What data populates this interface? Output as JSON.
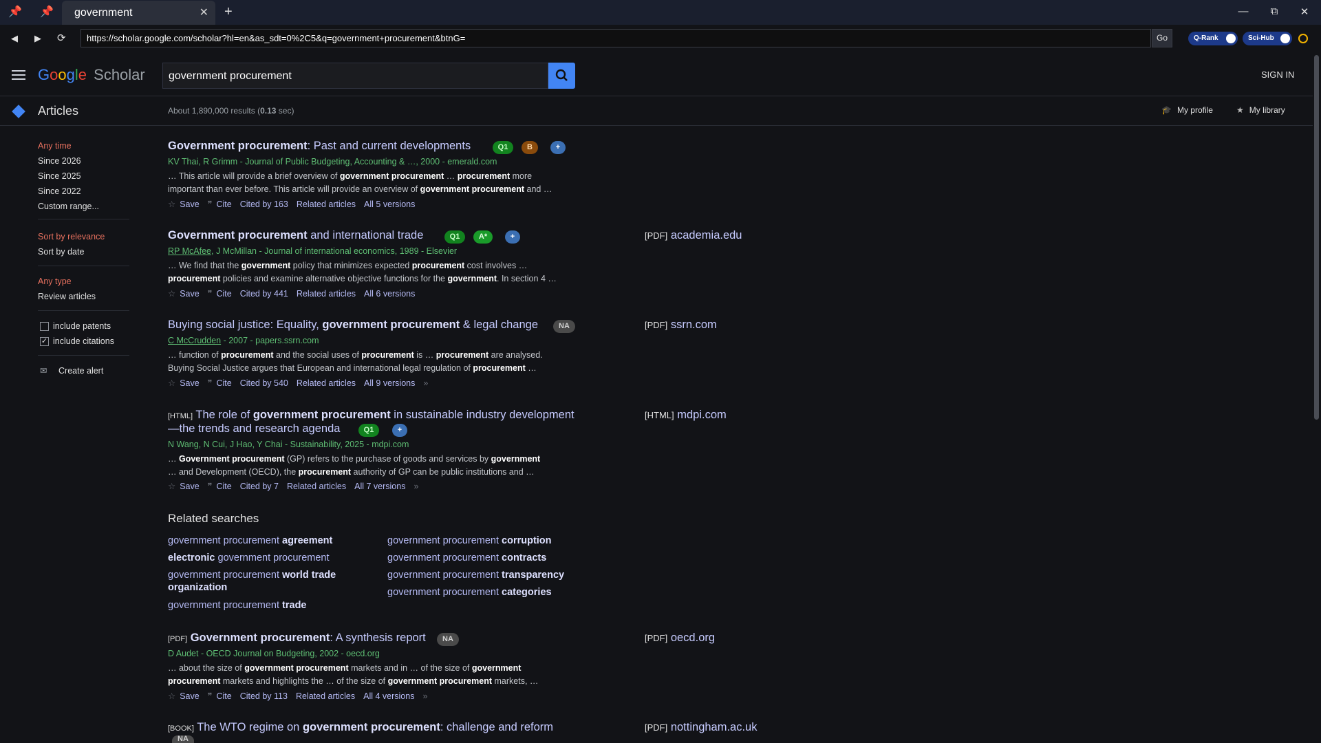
{
  "browser": {
    "tab_title": "government",
    "tab_close": "✕",
    "new_tab": "+",
    "url": "https://scholar.google.com/scholar?hl=en&as_sdt=0%2C5&q=government+procurement&btnG=",
    "go_label": "Go",
    "qrank_label": "Q-Rank",
    "scihub_label": "Sci-Hub",
    "min": "—",
    "restore": "⧉",
    "close": "✕"
  },
  "header": {
    "logo_google": [
      "G",
      "o",
      "o",
      "g",
      "l",
      "e"
    ],
    "logo_scholar": "Scholar",
    "search_value": "government procurement",
    "signin": "SIGN IN"
  },
  "subbar": {
    "articles": "Articles",
    "result_count": "About 1,890,000 results (",
    "result_time": "0.13",
    "result_tail": " sec)",
    "my_profile": "My profile",
    "my_library": "My library"
  },
  "sidebar": {
    "time": [
      "Any time",
      "Since 2026",
      "Since 2025",
      "Since 2022",
      "Custom range..."
    ],
    "sort": [
      "Sort by relevance",
      "Sort by date"
    ],
    "type": [
      "Any type",
      "Review articles"
    ],
    "include_patents": "include patents",
    "include_citations": "include citations",
    "check_mark": "✓",
    "create_alert": "Create alert"
  },
  "actions": {
    "save": "Save",
    "cite": "Cite",
    "related": "Related articles"
  },
  "results": [
    {
      "title_b": "Government procurement",
      "title_rest": ": Past and current developments",
      "tags": [
        "Q1",
        "B",
        "+"
      ],
      "authors": "KV Thai, R Grimm - Journal of Public Budgeting, Accounting & …, 2000 - emerald.com",
      "snip1_parts": [
        "… This article will provide a brief overview of ",
        "government procurement",
        " … ",
        "procurement",
        " more"
      ],
      "snip2_parts": [
        "important than ever before. This article will provide an overview of ",
        "government procurement",
        " and …"
      ],
      "cited": "Cited by 163",
      "versions": "All 5 versions"
    },
    {
      "title_b": "Government procurement",
      "title_rest": " and international trade",
      "tags": [
        "Q1",
        "A*",
        "+"
      ],
      "authors_link": "RP McAfee",
      "authors": ", J McMillan - Journal of international economics, 1989 - Elsevier",
      "snip1_parts": [
        "… We find that the ",
        "government",
        " policy that minimizes expected ",
        "procurement",
        " cost involves …"
      ],
      "snip2_parts": [
        "",
        "procurement",
        " policies and examine alternative objective functions for the ",
        "government",
        ". In section 4 …"
      ],
      "cited": "Cited by 441",
      "versions": "All 6 versions",
      "side_kind": "[PDF]",
      "side_src": "academia.edu"
    },
    {
      "title_pre": "Buying social justice: Equality, ",
      "title_b": "government procurement",
      "title_rest": " & legal change",
      "tags": [
        "NA"
      ],
      "authors_link": "C McCrudden",
      "authors": " - 2007 - papers.ssrn.com",
      "snip1_parts": [
        "… function of ",
        "procurement",
        " and the social uses of ",
        "procurement",
        " is … ",
        "procurement",
        " are analysed."
      ],
      "snip2_parts": [
        "Buying Social Justice argues that European and international legal regulation of ",
        "procurement",
        " …"
      ],
      "cited": "Cited by 540",
      "versions": "All 9 versions",
      "side_kind": "[PDF]",
      "side_src": "ssrn.com"
    },
    {
      "kind": "[HTML]",
      "title_pre": "The role of ",
      "title_b": "government procurement",
      "title_rest": " in sustainable industry development",
      "title_line2": "—the trends and research agenda",
      "tags": [
        "Q1",
        "+"
      ],
      "authors": "N Wang, N Cui, J Hao, Y Chai - Sustainability, 2025 - mdpi.com",
      "snip1_parts": [
        "… ",
        "Government procurement",
        " (GP) refers to the purchase of goods and services by ",
        "government",
        ""
      ],
      "snip2_parts": [
        "… and Development (OECD), the ",
        "procurement",
        " authority of GP can be public institutions and …"
      ],
      "cited": "Cited by 7",
      "versions": "All 7 versions",
      "side_kind": "[HTML]",
      "side_src": "mdpi.com"
    },
    {
      "kind": "[PDF]",
      "title_b": "Government procurement",
      "title_rest": ": A synthesis report",
      "tags": [
        "NA"
      ],
      "authors": "D Audet - OECD Journal on Budgeting, 2002 - oecd.org",
      "snip1_parts": [
        "… about the size of ",
        "government procurement",
        " markets and in … of the size of ",
        "government",
        ""
      ],
      "snip2_parts": [
        "",
        "procurement",
        " markets and highlights the … of the size of ",
        "government procurement",
        " markets, …"
      ],
      "cited": "Cited by 113",
      "versions": "All 4 versions",
      "side_kind": "[PDF]",
      "side_src": "oecd.org"
    },
    {
      "kind": "[BOOK]",
      "title_pre": "The WTO regime on ",
      "title_b": "government procurement",
      "title_rest": ": challenge and reform",
      "tags": [
        "NA"
      ],
      "side_kind": "[PDF]",
      "side_src": "nottingham.ac.uk"
    }
  ],
  "related": {
    "title": "Related searches",
    "items": [
      [
        "government procurement ",
        "agreement"
      ],
      [
        "government procurement ",
        "corruption"
      ],
      [
        "electronic",
        " government procurement"
      ],
      [
        "government procurement ",
        "contracts"
      ],
      [
        "government procurement ",
        "world trade"
      ],
      [
        "organization",
        ""
      ],
      [
        "government procurement ",
        "transparency"
      ],
      [
        "government procurement ",
        "trade"
      ],
      [
        "government procurement ",
        "categories"
      ]
    ]
  }
}
